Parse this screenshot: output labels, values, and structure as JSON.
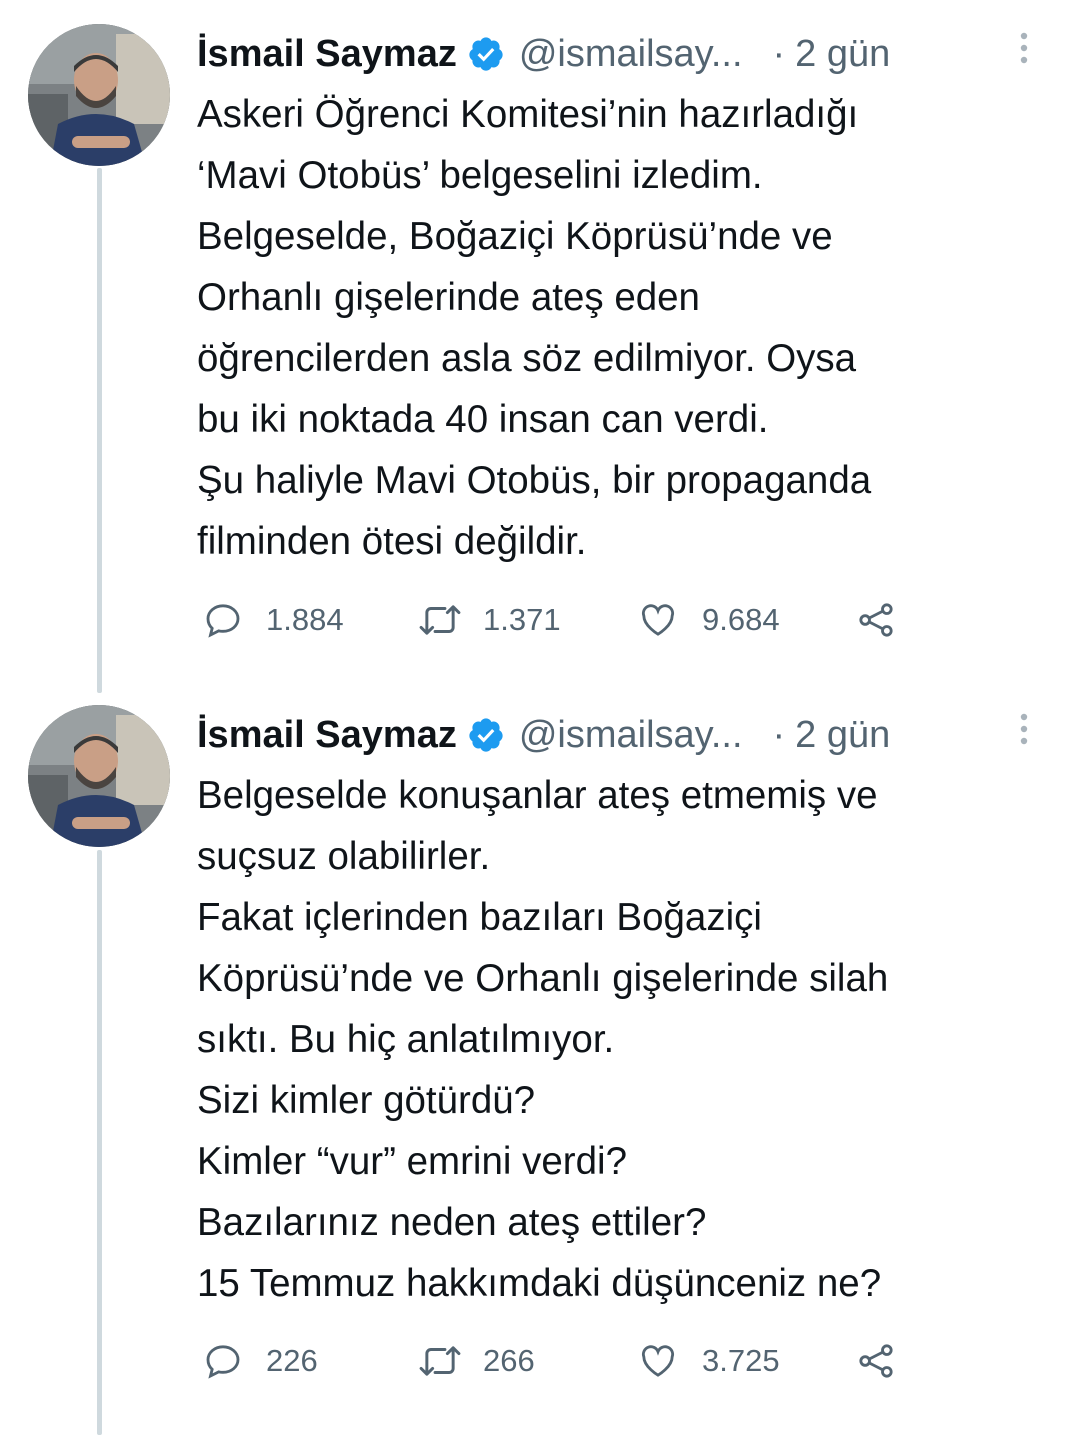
{
  "tweets": [
    {
      "author": {
        "name": "İsmail Saymaz",
        "handle": "@ismailsay...",
        "verified_icon": "verified-badge-icon"
      },
      "time": "2 gün",
      "separator": "·",
      "text": "Askeri Öğrenci Komitesi’nin hazırladığı\n‘Mavi Otobüs’ belgeselini izledim.\nBelgeselde, Boğaziçi Köprüsü’nde ve\nOrhanlı gişelerinde ateş eden\nöğrencilerden asla söz edilmiyor. Oysa\nbu iki noktada 40 insan can verdi.\nŞu haliyle Mavi Otobüs, bir propaganda\nfilminden ötesi değildir.",
      "actions": {
        "reply_count": "1.884",
        "retweet_count": "1.371",
        "like_count": "9.684"
      }
    },
    {
      "author": {
        "name": "İsmail Saymaz",
        "handle": "@ismailsay...",
        "verified_icon": "verified-badge-icon"
      },
      "time": "2 gün",
      "separator": "·",
      "text": "Belgeselde konuşanlar ateş etmemiş ve\nsuçsuz olabilirler.\nFakat içlerinden bazıları Boğaziçi\nKöprüsü’nde ve Orhanlı gişelerinde silah\nsıktı. Bu hiç anlatılmıyor.\nSizi kimler götürdü?\nKimler “vur” emrini verdi?\nBazılarınız neden ateş ettiler?\n15 Temmuz hakkımdaki düşünceniz ne?",
      "actions": {
        "reply_count": "226",
        "retweet_count": "266",
        "like_count": "3.725"
      }
    }
  ],
  "colors": {
    "text_primary": "#0f1419",
    "text_secondary": "#536471",
    "verified_blue": "#1d9bf0",
    "thread_line": "#cfd9de"
  },
  "icons": [
    "avatar-photo",
    "verified-badge-icon",
    "more-options-icon",
    "reply-icon",
    "retweet-icon",
    "like-icon",
    "share-icon"
  ]
}
